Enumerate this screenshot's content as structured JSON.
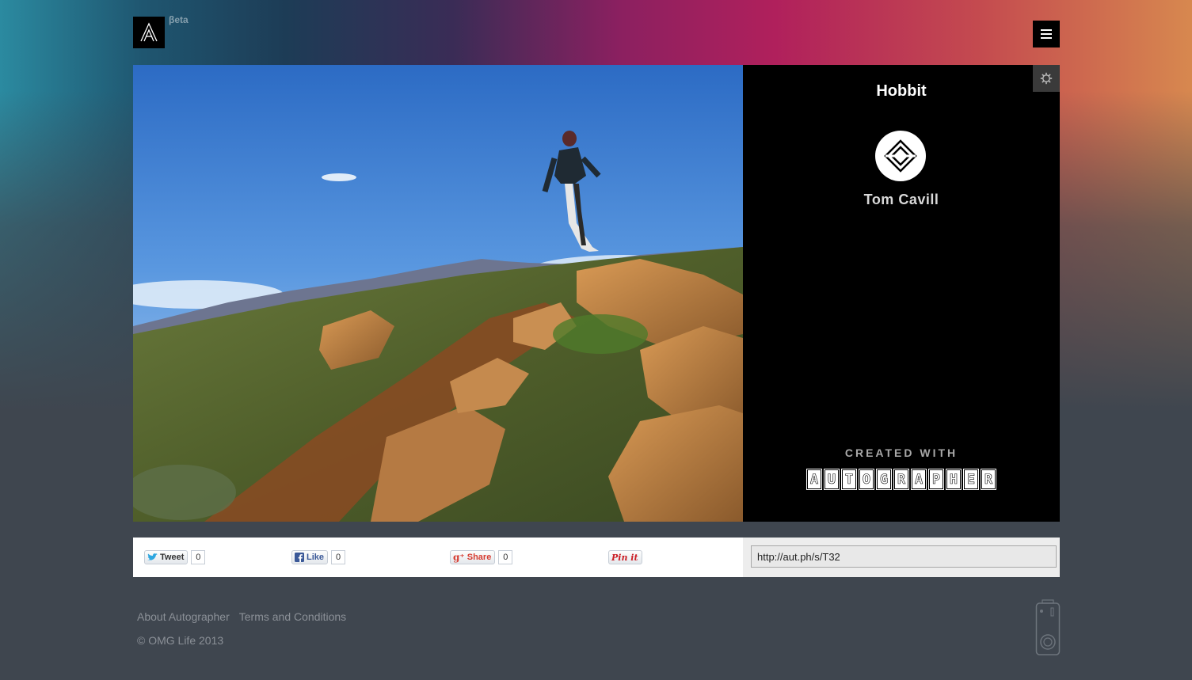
{
  "header": {
    "logo_letter": "A",
    "beta_label": "βeta",
    "menu_icon": "hamburger-menu-icon"
  },
  "photo": {
    "description_icon": "landscape-photo"
  },
  "side_panel": {
    "title": "Hobbit",
    "author_name": "Tom Cavill",
    "settings_icon": "gear-icon",
    "created_with_label": "CREATED WITH",
    "brand_letters": [
      "A",
      "U",
      "T",
      "O",
      "G",
      "R",
      "A",
      "P",
      "H",
      "E",
      "R"
    ]
  },
  "share": {
    "tweet_label": "Tweet",
    "tweet_count": "0",
    "like_label": "Like",
    "like_count": "0",
    "gplus_label": "Share",
    "gplus_count": "0",
    "pin_label": "Pin it"
  },
  "url": {
    "value": "http://aut.ph/s/T32"
  },
  "footer": {
    "about_link": "About Autographer",
    "terms_link": "Terms and Conditions",
    "copyright": "© OMG Life 2013"
  },
  "colors": {
    "page_bg": "#3f464f",
    "panel_bg": "#000000",
    "gradient_start": "#2b8aa0",
    "gradient_mid": "#b0205c",
    "gradient_end": "#d7884f"
  }
}
